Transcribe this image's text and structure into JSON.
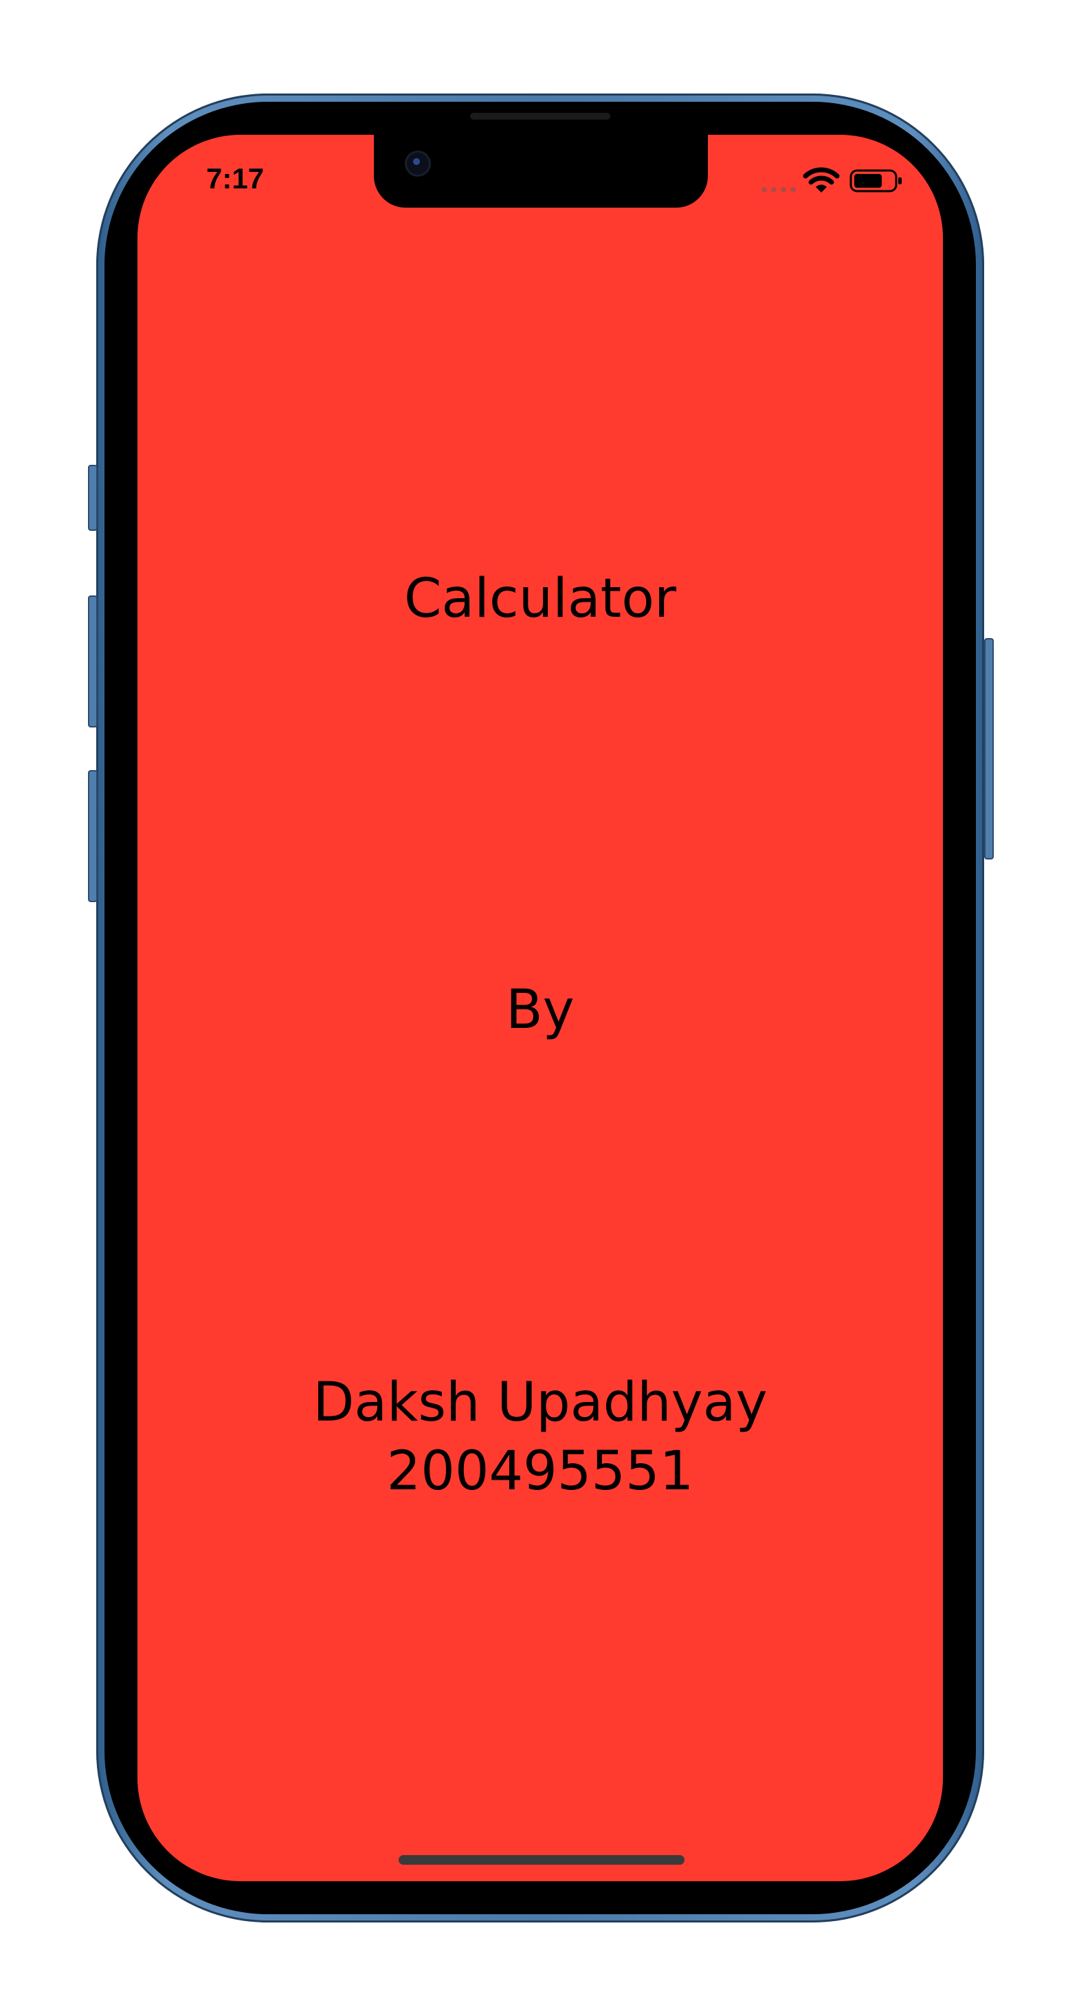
{
  "status_bar": {
    "time": "7:17"
  },
  "screen": {
    "heading": "Calculator",
    "by_label": "By",
    "author_name": "Daksh Upadhyay",
    "author_id": "200495551"
  },
  "colors": {
    "screen_background": "#ff3b30",
    "frame": "#4a7aaa"
  },
  "icons": [
    "wifi-icon",
    "battery-icon",
    "camera-icon"
  ]
}
